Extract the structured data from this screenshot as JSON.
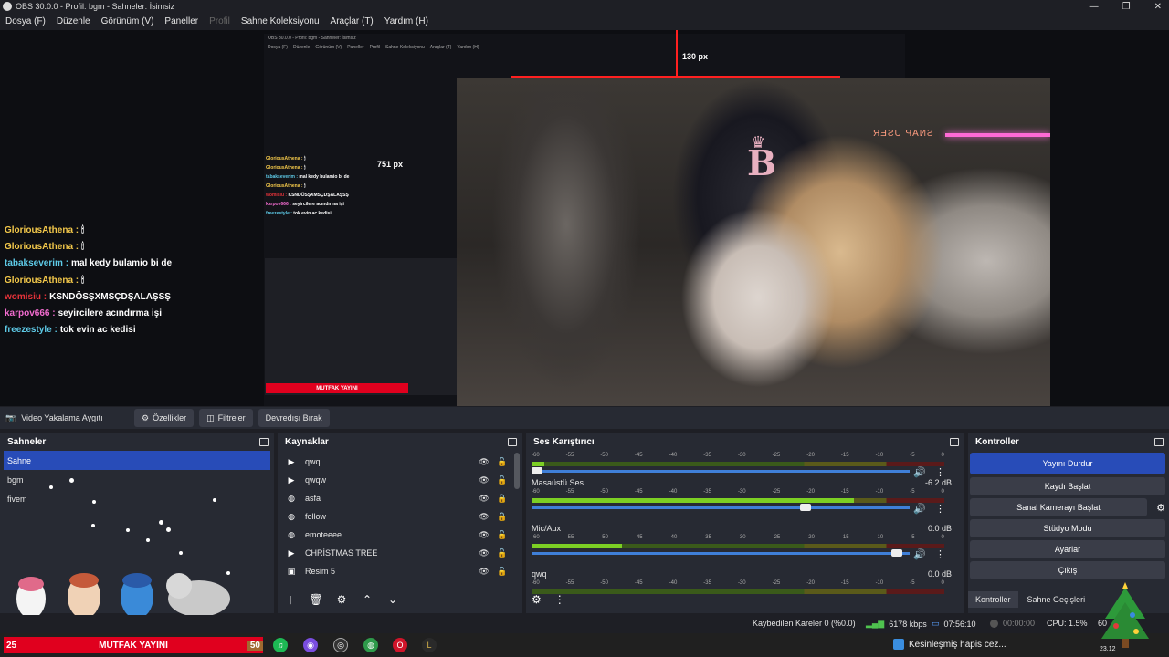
{
  "window": {
    "title": "OBS 30.0.0 - Profil: bgm - Sahneler: İsimsiz",
    "controls": [
      "—",
      "❐",
      "✕"
    ]
  },
  "menu": [
    "Dosya (F)",
    "Düzenle",
    "Görünüm (V)",
    "Paneller",
    "Profil",
    "Sahne Koleksiyonu",
    "Araçlar (T)",
    "Yardım (H)"
  ],
  "preview": {
    "nested_title": "OBS 30.0.0 - Profil: bgm - Sahneler: İsimsiz",
    "nested_menu": [
      "Dosya (F)",
      "Düzenle",
      "Görünüm (V)",
      "Paneller",
      "Profil",
      "Sahne Koleksiyonu",
      "Araçlar (T)",
      "Yardım (H)"
    ],
    "ruler_top": "130 px",
    "ruler_left": "751 px",
    "neon_sign": "SNAP USER",
    "mini_stream_label": "MUTFAK YAYINI",
    "chat": [
      {
        "user": "GloriousAthena :",
        "msg": "🕯",
        "color": "#f3c84a"
      },
      {
        "user": "GloriousAthena :",
        "msg": "🕯",
        "color": "#f3c84a"
      },
      {
        "user": "tabakseverim :",
        "msg": "mal kedy bulamio bi de",
        "color": "#5ecbe8"
      },
      {
        "user": "GloriousAthena :",
        "msg": "🕯",
        "color": "#f3c84a"
      },
      {
        "user": "womisiu :",
        "msg": "KSNDÖSŞXMSÇDŞALAŞSŞ",
        "color": "#e8333a"
      },
      {
        "user": "karpov666 :",
        "msg": "seyircilere acındırma işi",
        "color": "#f26ccf"
      },
      {
        "user": "freezestyle :",
        "msg": "tok evin ac kedisi",
        "color": "#5ecbe8"
      }
    ]
  },
  "source_toolbar": {
    "source_name": "Video Yakalama Aygıtı",
    "properties": "Özellikler",
    "filters": "Filtreler",
    "deactivate": "Devredışı Bırak"
  },
  "scenes": {
    "title": "Sahneler",
    "items": [
      "Sahne",
      "bgm",
      "fivem"
    ],
    "active": 0
  },
  "sources": {
    "title": "Kaynaklar",
    "items": [
      {
        "name": "qwq",
        "kind": "▶",
        "locked": false
      },
      {
        "name": "qwqw",
        "kind": "▶",
        "locked": false
      },
      {
        "name": "asfa",
        "kind": "◍",
        "locked": true
      },
      {
        "name": "follow",
        "kind": "◍",
        "locked": true
      },
      {
        "name": "emoteeee",
        "kind": "◍",
        "locked": false
      },
      {
        "name": "CHRİSTMAS TREE",
        "kind": "▶",
        "locked": false
      },
      {
        "name": "Resim 5",
        "kind": "▣",
        "locked": false
      }
    ]
  },
  "mixer": {
    "title": "Ses Karıştırıcı",
    "scale": [
      "-60",
      "-55",
      "-50",
      "-45",
      "-40",
      "-35",
      "-30",
      "-25",
      "-20",
      "-15",
      "-10",
      "-5",
      "0"
    ],
    "channels": [
      {
        "name": "",
        "db": "",
        "level": 0.03,
        "fader": 0.03
      },
      {
        "name": "Masaüstü Ses",
        "db": "-6.2 dB",
        "level": 0.78,
        "fader": 0.74
      },
      {
        "name": "Mic/Aux",
        "db": "0.0 dB",
        "level": 0.22,
        "fader": 0.98
      },
      {
        "name": "qwq",
        "db": "0.0 dB",
        "level": 0.0,
        "fader": 0.98
      }
    ]
  },
  "controls": {
    "title": "Kontroller",
    "stop_stream": "Yayını Durdur",
    "start_recording": "Kaydı Başlat",
    "start_virtualcam": "Sanal Kamerayı Başlat",
    "studio_mode": "Stüdyo Modu",
    "settings": "Ayarlar",
    "exit": "Çıkış",
    "tabs": [
      "Kontroller",
      "Sahne Geçişleri"
    ]
  },
  "status": {
    "dropped_frames": "Kaybedilen Kareler 0 (%0.0)",
    "bitrate": "6178 kbps",
    "stream_time": "07:56:10",
    "record_time": "00:00:00",
    "cpu": "CPU: 1.5%",
    "fps": "60"
  },
  "taskbar": {
    "stream_strip_num": "25",
    "stream_strip_label": "MUTFAK YAYINI",
    "stream_strip_right": "50",
    "notice": "Kesinleşmiş hapis cez...",
    "clock": "23.12"
  },
  "colors": {
    "accent": "#284cb8",
    "panel": "#272a33",
    "bg": "#1e1f25",
    "meter_green": "#7ccf24",
    "stream_red": "#e0001e"
  }
}
